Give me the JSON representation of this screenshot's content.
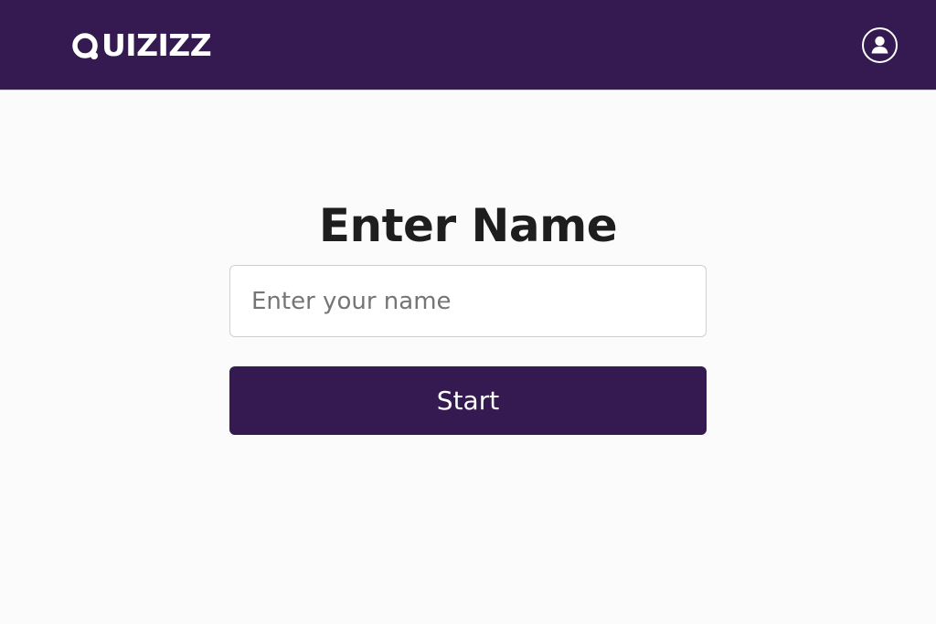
{
  "header": {
    "logo_text": "UIZIZZ",
    "logo_icon": "quizizz-q-logo",
    "profile_icon": "user-circle-icon"
  },
  "main": {
    "title": "Enter Name",
    "name_input": {
      "placeholder": "Enter your name",
      "value": ""
    },
    "start_label": "Start"
  },
  "colors": {
    "brand": "#341a50",
    "background": "#fbfbfb",
    "title_text": "#1e1e1e",
    "input_border": "#cfcfcf",
    "placeholder_text": "#757575"
  }
}
